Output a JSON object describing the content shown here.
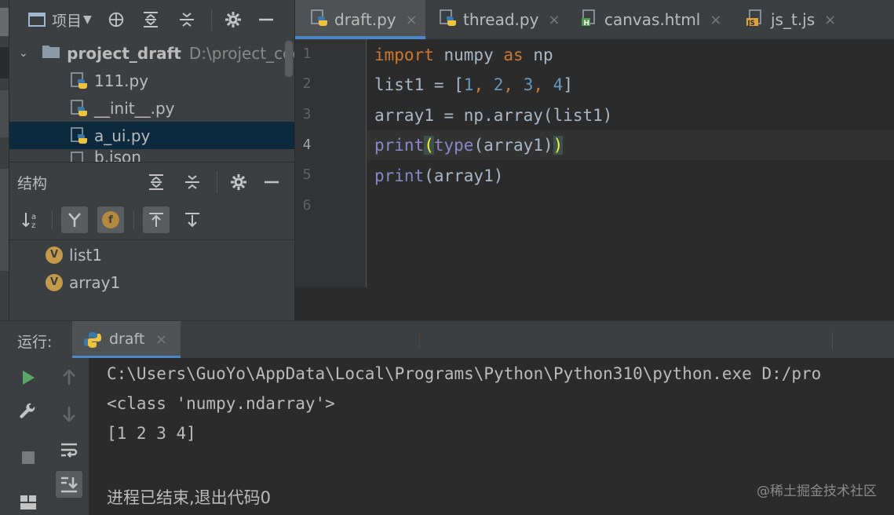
{
  "project_panel": {
    "title": "项目",
    "root_folder": "project_draft",
    "root_path": "D:\\project_coc",
    "files": [
      "111.py",
      "__init__.py",
      "a_ui.py",
      "b.json"
    ],
    "selected_file": "a_ui.py"
  },
  "structure_panel": {
    "title": "结构",
    "items": [
      {
        "badge": "V",
        "name": "list1"
      },
      {
        "badge": "V",
        "name": "array1"
      }
    ]
  },
  "editor": {
    "tabs": [
      {
        "label": "draft.py",
        "icon": "python-file-icon",
        "active": true
      },
      {
        "label": "thread.py",
        "icon": "python-file-icon",
        "active": false
      },
      {
        "label": "canvas.html",
        "icon": "html-file-icon",
        "active": false
      },
      {
        "label": "js_t.js",
        "icon": "js-file-icon",
        "active": false
      }
    ],
    "line_numbers": [
      "1",
      "2",
      "3",
      "4",
      "5",
      "6"
    ],
    "current_line": 4,
    "code": {
      "line1": {
        "kw_import": "import",
        "module": " numpy ",
        "kw_as": "as",
        "alias": " np"
      },
      "line2": {
        "lhs": "list1 = [",
        "n1": "1",
        "c1": ", ",
        "n2": "2",
        "c2": ", ",
        "n3": "3",
        "c3": ", ",
        "n4": "4",
        "close": "]"
      },
      "line3": {
        "text": "array1 = np.array(list1)"
      },
      "line4": {
        "print": "print",
        "open_paren": "(",
        "type": "type",
        "inner": "(array1)",
        "close_paren": ")"
      },
      "line5": {
        "print": "print",
        "rest": "(array1)"
      }
    }
  },
  "run_panel": {
    "label": "运行:",
    "tab_label": "draft",
    "output": [
      "C:\\Users\\GuoYo\\AppData\\Local\\Programs\\Python\\Python310\\python.exe D:/pro",
      "<class 'numpy.ndarray'>",
      "[1 2 3 4]",
      "",
      "进程已结束,退出代码0"
    ]
  },
  "watermark": "@稀土掘金技术社区",
  "colors": {
    "background": "#2b2b2b",
    "panel": "#3c3f41",
    "keyword": "#cc7832",
    "number": "#6897bb",
    "builtin": "#8888c6",
    "selection": "#0d293e",
    "accent": "#4a88c7"
  }
}
